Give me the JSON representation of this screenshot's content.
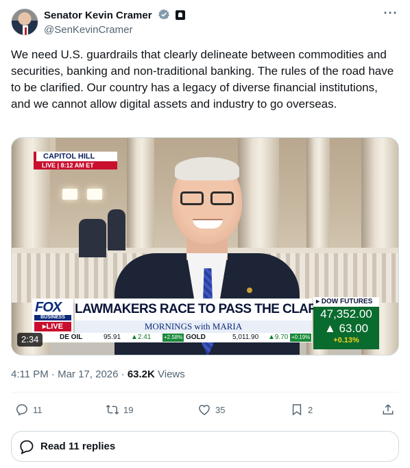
{
  "author": {
    "display_name": "Senator Kevin Cramer",
    "handle": "@SenKevinCramer",
    "verified_color": "#829aab"
  },
  "tweet": {
    "text": "We need U.S. guardrails that clearly delineate between commodities and securities, banking and non-traditional banking. The rules of the road have to be clarified. Our country has a legacy of diverse financial institutions, and we cannot allow digital assets and industry to go overseas.",
    "time": "4:11 PM · Mar 17, 2026 · ",
    "views_count": "63.2K",
    "views_label": " Views"
  },
  "video": {
    "duration": "2:34",
    "chyron_place": "CAPITOL HILL",
    "chyron_live": "LIVE | 8:12 AM ET",
    "network_word": "FOX",
    "network_sub": "BUSINESS",
    "network_live": "▸LIVE",
    "headline": "LAWMAKERS RACE TO PASS THE CLARITY ACT",
    "show_name": "MORNINGS with MARIA",
    "ticker": {
      "oil_label": "DE OIL",
      "oil_value": "95.91",
      "oil_change": "▲2.41",
      "oil_pct": "+2.58%",
      "gold_label": "GOLD",
      "gold_value": "5,011.90",
      "gold_change": "▲9.70",
      "gold_pct": "+0.19%"
    },
    "dow": {
      "title": "▸ DOW FUTURES",
      "value": "47,352.00",
      "change": "▲ 63.00",
      "pct": "+0.13%"
    }
  },
  "actions": {
    "replies": "11",
    "reposts": "19",
    "likes": "35",
    "bookmarks": "2"
  },
  "read_replies": {
    "label": "Read 11 replies"
  },
  "more_menu": "···"
}
